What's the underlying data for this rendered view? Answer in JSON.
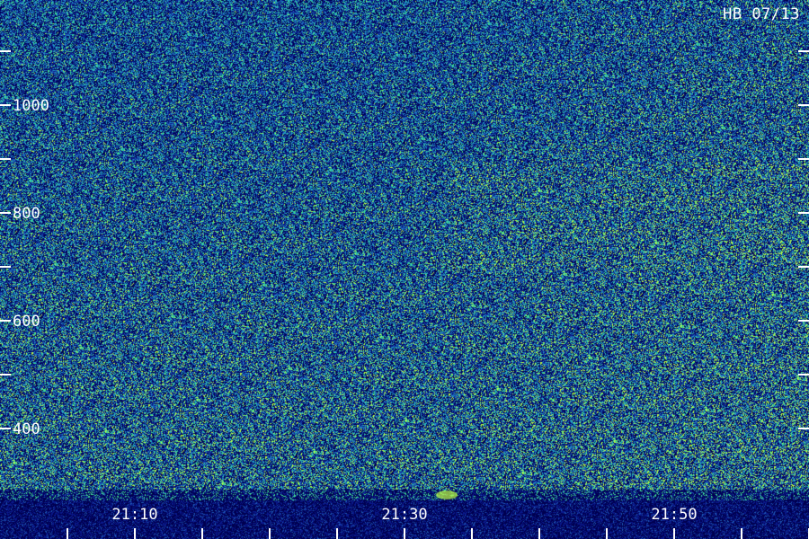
{
  "chart_data": {
    "type": "heatmap",
    "title": "HB 07/13",
    "xlabel": "",
    "ylabel": "",
    "x_tick_labels": [
      "21:10",
      "21:30",
      "21:50"
    ],
    "y_tick_labels": [
      "1000",
      "800",
      "600",
      "400"
    ],
    "y_ticks": [
      400,
      500,
      600,
      700,
      800,
      900,
      1000,
      1100
    ],
    "x_ticks_minutes": [
      0,
      5,
      10,
      15,
      20,
      25,
      30,
      35,
      40,
      45,
      50,
      55
    ],
    "ylim": [
      300,
      1200
    ],
    "xlim": [
      "21:05",
      "21:57"
    ],
    "grid": false,
    "colormap": [
      "#000050",
      "#0a1a8c",
      "#1e5ab4",
      "#20a0c8",
      "#40e090",
      "#c0ff40"
    ],
    "background_color": "#0a1a6a"
  }
}
